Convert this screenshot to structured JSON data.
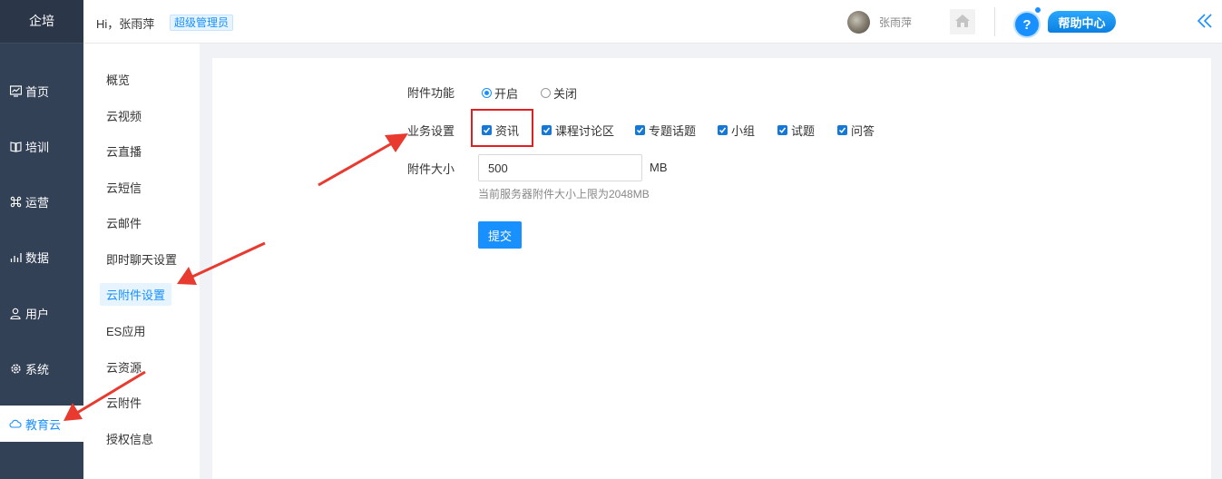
{
  "sidebar": {
    "logo": "企培",
    "items": [
      {
        "label": "首页",
        "icon": "dashboard-icon"
      },
      {
        "label": "培训",
        "icon": "training-icon"
      },
      {
        "label": "运营",
        "icon": "command-icon"
      },
      {
        "label": "数据",
        "icon": "chart-icon"
      },
      {
        "label": "用户",
        "icon": "user-icon"
      },
      {
        "label": "系统",
        "icon": "gear-icon"
      },
      {
        "label": "教育云",
        "icon": "cloud-icon",
        "active": true
      }
    ]
  },
  "header": {
    "greeting": "Hi，张雨萍",
    "role": "超级管理员",
    "user_name": "张雨萍",
    "help_label": "帮助中心",
    "help_symbol": "?"
  },
  "submenu": {
    "items": [
      "概览",
      "云视频",
      "云直播",
      "云短信",
      "云邮件",
      "即时聊天设置",
      "云附件设置",
      "ES应用",
      "云资源",
      "云附件",
      "授权信息"
    ],
    "active_index": 6
  },
  "form": {
    "attach_label": "附件功能",
    "radio_on": "开启",
    "radio_off": "关闭",
    "business_label": "业务设置",
    "checkboxes": [
      "资讯",
      "课程讨论区",
      "专题话题",
      "小组",
      "试题",
      "问答"
    ],
    "size_label": "附件大小",
    "size_value": "500",
    "size_unit": "MB",
    "size_hint": "当前服务器附件大小上限为2048MB",
    "submit": "提交"
  },
  "colors": {
    "sidebar_bg": "#334157",
    "accent": "#1890ff",
    "annotation": "#e02020"
  }
}
